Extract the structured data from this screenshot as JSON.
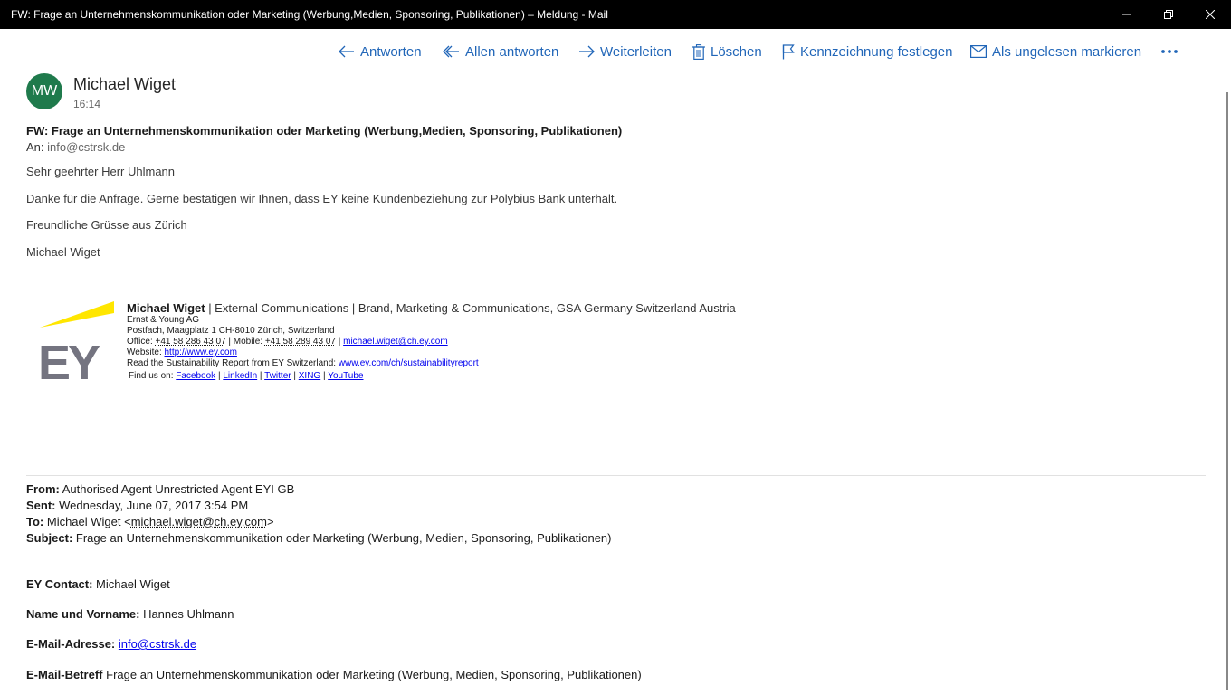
{
  "window": {
    "title": "FW: Frage an Unternehmenskommunikation oder Marketing (Werbung,Medien, Sponsoring, Publikationen) – Meldung - Mail"
  },
  "toolbar": {
    "reply": "Antworten",
    "reply_all": "Allen antworten",
    "forward": "Weiterleiten",
    "delete": "Löschen",
    "flag": "Kennzeichnung festlegen",
    "mark_unread": "Als ungelesen markieren",
    "accent": "#2166b8"
  },
  "message": {
    "avatar_initials": "MW",
    "avatar_color": "#1f7a4c",
    "sender": "Michael Wiget",
    "time": "16:14",
    "subject": "FW: Frage an Unternehmenskommunikation oder Marketing (Werbung,Medien, Sponsoring, Publikationen)",
    "to_label": "An:",
    "to_address": "info@cstrsk.de",
    "body": [
      "Sehr geehrter Herr Uhlmann",
      "Danke für die Anfrage. Gerne bestätigen wir Ihnen, dass EY keine Kundenbeziehung zur Polybius Bank unterhält.",
      "Freundliche Grüsse aus Zürich",
      "Michael Wiget"
    ]
  },
  "signature": {
    "name": "Michael Wiget",
    "title": " | External Communications | Brand, Marketing & Communications, GSA Germany Switzerland Austria",
    "company": "Ernst & Young AG",
    "address": "Postfach, Maagplatz 1 CH-8010 Zürich, Switzerland",
    "office_label": "Office: ",
    "office_phone": "+41 58 286 43 07",
    "mobile_label": " | Mobile: ",
    "mobile_phone": "+41 58 289 43 07",
    "sep": " | ",
    "email": "michael.wiget@ch.ey.com",
    "website_label": "Website: ",
    "website": "http://www.ey.com",
    "report_label": "Read the Sustainability Report from EY Switzerland: ",
    "report_link": "www.ey.com/ch/sustainabilityreport",
    "findus_label": "Find us on: ",
    "social": [
      "Facebook",
      "LinkedIn",
      "Twitter",
      "XING",
      "YouTube"
    ],
    "logo_text": "EY",
    "logo_yellow": "#ffe600",
    "logo_gray": "#747480"
  },
  "forwarded": {
    "from_label": "From:",
    "from": " Authorised Agent Unrestricted Agent EYI GB",
    "sent_label": "Sent:",
    "sent": " Wednesday, June 07, 2017 3:54 PM",
    "to_label": "To:",
    "to_name": " Michael Wiget <",
    "to_email": "michael.wiget@ch.ey.com",
    "to_close": ">",
    "subject_label": "Subject:",
    "subject": " Frage an Unternehmenskommunikation oder Marketing (Werbung, Medien, Sponsoring, Publikationen)"
  },
  "fields": {
    "contact_label": "EY Contact:",
    "contact": " Michael Wiget",
    "name_label": "Name und Vorname:",
    "name": " Hannes Uhlmann",
    "email_label": "E-Mail-Adresse:",
    "email": "info@cstrsk.de",
    "subject_label": "E-Mail-Betreff",
    "subject": " Frage an Unternehmenskommunikation oder Marketing (Werbung, Medien, Sponsoring, Publikationen)"
  }
}
